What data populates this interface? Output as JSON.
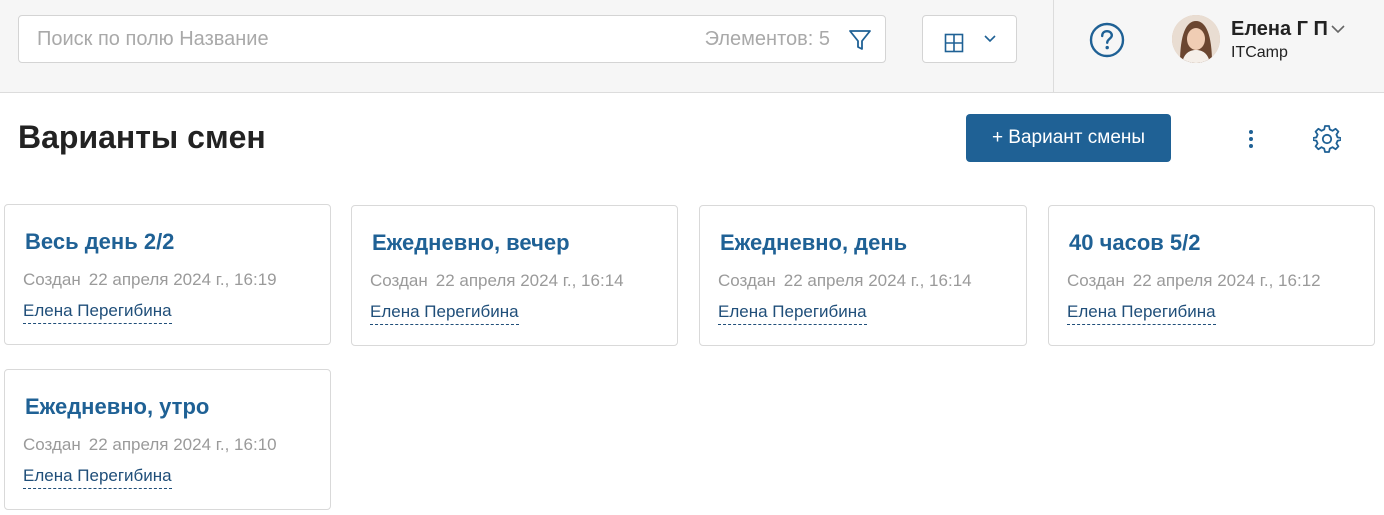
{
  "search": {
    "placeholder": "Поиск по полю Название",
    "count_label": "Элементов: 5"
  },
  "user": {
    "name": "Елена Г П",
    "company": "ITCamp"
  },
  "page": {
    "title": "Варианты смен",
    "add_button_label": "+ Вариант смены"
  },
  "colors": {
    "accent": "#1f6195",
    "link": "#1f4e79"
  },
  "cards": [
    {
      "title": "Весь день 2/2",
      "created_label": "Создан",
      "date": "22 апреля 2024 г., 16:19",
      "author": "Елена Перегибина"
    },
    {
      "title": "Ежедневно, вечер",
      "created_label": "Создан",
      "date": "22 апреля 2024 г., 16:14",
      "author": "Елена Перегибина"
    },
    {
      "title": "Ежедневно, день",
      "created_label": "Создан",
      "date": "22 апреля 2024 г., 16:14",
      "author": "Елена Перегибина"
    },
    {
      "title": "40 часов 5/2",
      "created_label": "Создан",
      "date": "22 апреля 2024 г., 16:12",
      "author": "Елена Перегибина"
    },
    {
      "title": "Ежедневно, утро",
      "created_label": "Создан",
      "date": "22 апреля 2024 г., 16:10",
      "author": "Елена Перегибина"
    }
  ],
  "icons": {
    "filter": "filter-icon",
    "view": "grid-view-icon",
    "help": "help-icon",
    "more": "more-vertical-icon",
    "settings": "gear-icon"
  }
}
